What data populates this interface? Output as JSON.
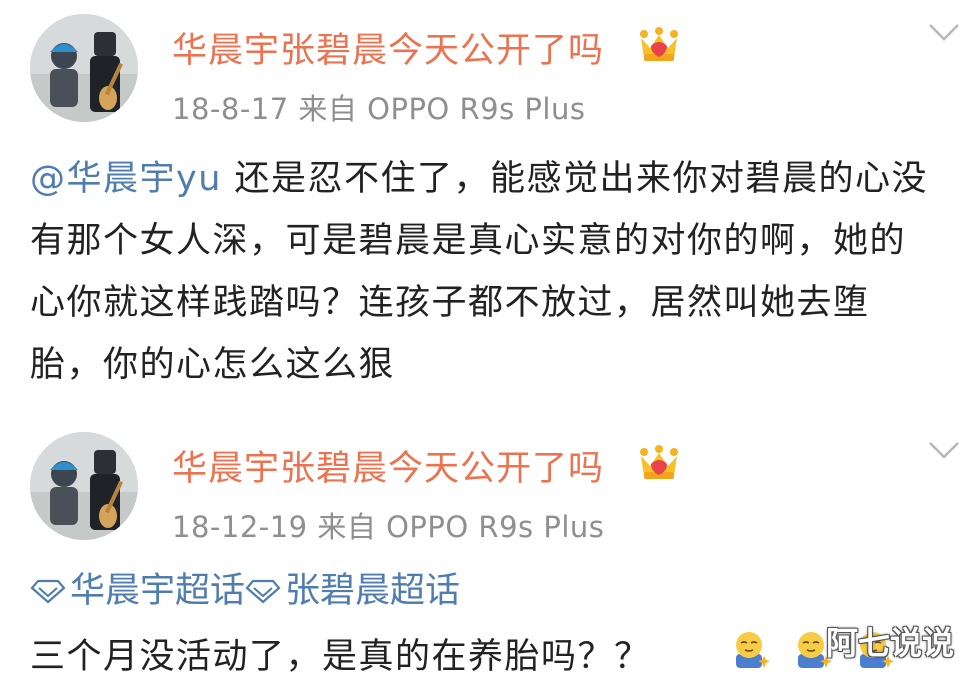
{
  "posts": [
    {
      "username": "华晨宇张碧晨今天公开了吗",
      "date": "18-8-17",
      "source": "来自 OPPO R9s Plus",
      "mention": "@华晨宇yu",
      "text": " 还是忍不住了，能感觉出来你对碧晨的心没有那个女人深，可是碧晨是真心实意的对你的啊，她的心你就这样践踏吗？连孩子都不放过，居然叫她去堕胎，你的心怎么这么狠",
      "badge_icon": "crown-icon",
      "menu_icon": "chevron-down-icon"
    },
    {
      "username": "华晨宇张碧晨今天公开了吗",
      "date": "18-12-19",
      "source": "来自 OPPO R9s Plus",
      "topics": [
        "华晨宇超话",
        "张碧晨超话"
      ],
      "text": "三个月没活动了，是真的在养胎吗？？",
      "emoji_icon": "bowing-face-icon",
      "badge_icon": "crown-icon",
      "menu_icon": "chevron-down-icon"
    }
  ],
  "watermark": "阿七说说",
  "colors": {
    "username": "#eb7350",
    "link": "#507daf",
    "meta": "#8f8f8f",
    "text": "#222222"
  }
}
